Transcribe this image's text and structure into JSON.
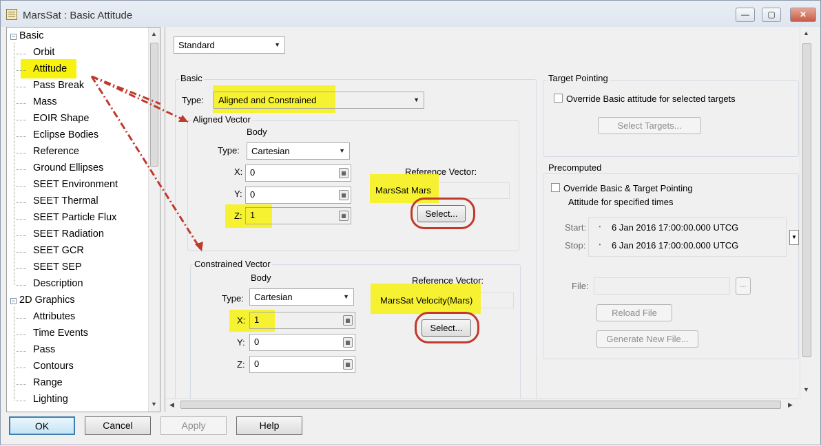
{
  "window": {
    "title": "MarsSat : Basic Attitude",
    "minimize": "—",
    "maximize": "▢",
    "close": "✕"
  },
  "tree": {
    "groups": [
      {
        "label": "Basic",
        "toggle": "−",
        "items": [
          "Orbit",
          "Attitude",
          "Pass Break",
          "Mass",
          "EOIR Shape",
          "Eclipse Bodies",
          "Reference",
          "Ground Ellipses",
          "SEET Environment",
          "SEET Thermal",
          "SEET Particle Flux",
          "SEET Radiation",
          "SEET GCR",
          "SEET SEP",
          "Description"
        ]
      },
      {
        "label": "2D Graphics",
        "toggle": "−",
        "items": [
          "Attributes",
          "Time Events",
          "Pass",
          "Contours",
          "Range",
          "Lighting"
        ]
      }
    ],
    "selected": "Attitude"
  },
  "mode_select": "Standard",
  "basic": {
    "group_label": "Basic",
    "type_label": "Type:",
    "type_value": "Aligned and Constrained",
    "aligned": {
      "group_label": "Aligned Vector",
      "body_label": "Body",
      "type_label": "Type:",
      "type_value": "Cartesian",
      "x_label": "X:",
      "x_value": "0",
      "y_label": "Y:",
      "y_value": "0",
      "z_label": "Z:",
      "z_value": "1",
      "ref_label": "Reference Vector:",
      "ref_value": "MarsSat Mars",
      "select_label": "Select..."
    },
    "constrained": {
      "group_label": "Constrained Vector",
      "body_label": "Body",
      "type_label": "Type:",
      "type_value": "Cartesian",
      "x_label": "X:",
      "x_value": "1",
      "y_label": "Y:",
      "y_value": "0",
      "z_label": "Z:",
      "z_value": "0",
      "ref_label": "Reference Vector:",
      "ref_value": "MarsSat Velocity(Mars)",
      "select_label": "Select..."
    }
  },
  "target_pointing": {
    "group_label": "Target Pointing",
    "override_label": "Override Basic attitude for selected targets",
    "select_targets": "Select Targets..."
  },
  "precomputed": {
    "group_label": "Precomputed",
    "override_label": "Override Basic & Target Pointing",
    "override_label2": "Attitude for specified times",
    "start_label": "Start:",
    "start_value": "6 Jan 2016 17:00:00.000 UTCG",
    "stop_label": "Stop:",
    "stop_value": "6 Jan 2016 17:00:00.000 UTCG",
    "file_label": "File:",
    "browse": "...",
    "reload": "Reload File",
    "generate": "Generate New File..."
  },
  "buttons": {
    "ok": "OK",
    "cancel": "Cancel",
    "apply": "Apply",
    "help": "Help"
  },
  "colors": {
    "highlight": "#f7f20f",
    "annotation": "#c0392b"
  }
}
